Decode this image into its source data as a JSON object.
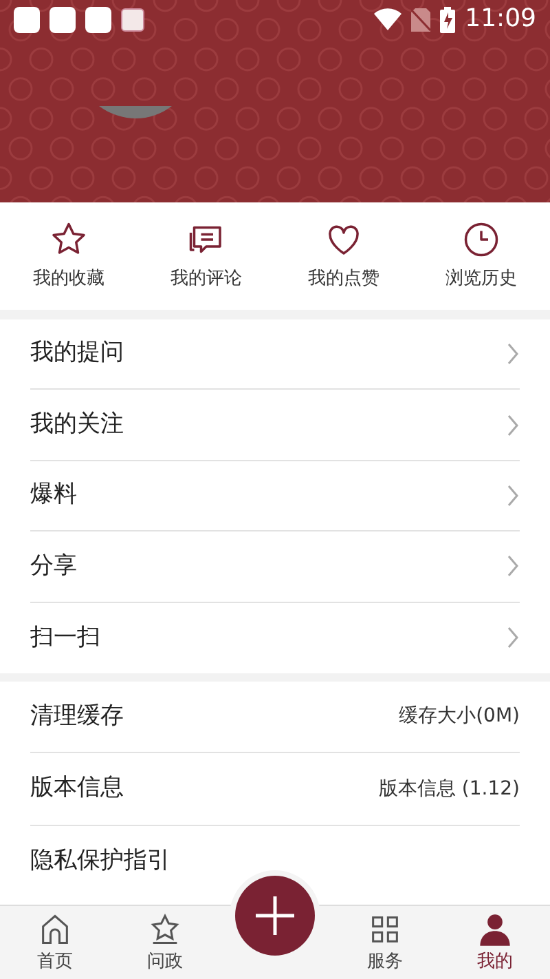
{
  "status_bar": {
    "time": "11:09"
  },
  "shortcuts": [
    {
      "kind": "star",
      "label": "我的收藏"
    },
    {
      "kind": "comment",
      "label": "我的评论"
    },
    {
      "kind": "heart",
      "label": "我的点赞"
    },
    {
      "kind": "clock",
      "label": "浏览历史"
    }
  ],
  "menu_items": [
    {
      "label": "我的提问"
    },
    {
      "label": "我的关注"
    },
    {
      "label": "爆料"
    },
    {
      "label": "分享"
    },
    {
      "label": "扫一扫"
    }
  ],
  "settings": [
    {
      "label": "清理缓存",
      "value": "缓存大小(0M)"
    },
    {
      "label": "版本信息",
      "value": "版本信息 (1.12)"
    },
    {
      "label": "隐私保护指引"
    }
  ],
  "bottom_nav": [
    {
      "kind": "home",
      "label": "首页",
      "selected": false
    },
    {
      "kind": "star",
      "label": "问政",
      "selected": false
    },
    {
      "kind": "fab"
    },
    {
      "kind": "grid",
      "label": "服务",
      "selected": false
    },
    {
      "kind": "person",
      "label": "我的",
      "selected": true
    }
  ]
}
